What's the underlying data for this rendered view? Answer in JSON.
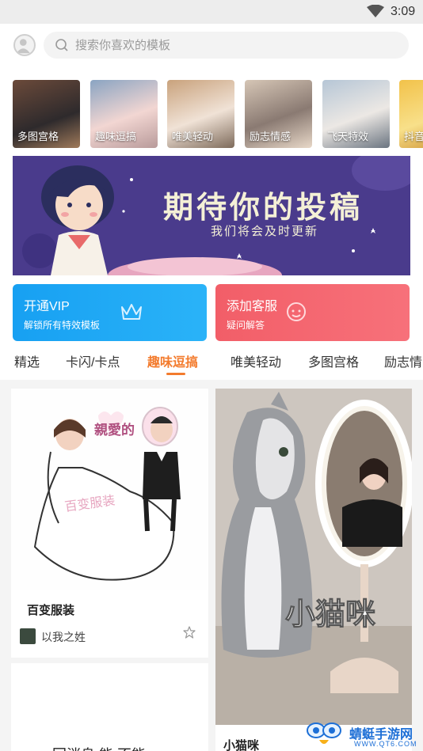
{
  "status_bar": {
    "time": "3:09"
  },
  "search": {
    "placeholder": "搜索你喜欢的模板"
  },
  "categories": [
    {
      "label": "多图宫格"
    },
    {
      "label": "趣味逗搞"
    },
    {
      "label": "唯美轻动"
    },
    {
      "label": "励志情感"
    },
    {
      "label": "飞天特效"
    },
    {
      "label": "抖音"
    }
  ],
  "banner": {
    "title": "期待你的投稿",
    "subtitle": "我们将会及时更新"
  },
  "promos": {
    "vip": {
      "title": "开通VIP",
      "subtitle": "解锁所有特效模板",
      "color": "#1ea6f5"
    },
    "service": {
      "title": "添加客服",
      "subtitle": "疑问解答",
      "color": "#f4606a"
    }
  },
  "tabs": [
    {
      "label": "精选"
    },
    {
      "label": "卡闪/卡点"
    },
    {
      "label": "趣味逗搞"
    },
    {
      "label": "唯美轻动"
    },
    {
      "label": "多图宫格"
    },
    {
      "label": "励志情"
    }
  ],
  "active_tab_color": "#f37b2d",
  "cards": {
    "left": {
      "art_text_top": "親愛的",
      "art_text_bottom": "百变服装",
      "title": "百变服装",
      "author": "以我之姓"
    },
    "left2": {
      "title": "回消息 能 不能"
    },
    "right": {
      "art_text": "小猫咪",
      "title": "小猫咪"
    }
  },
  "watermark": {
    "name": "蜻蜓手游网",
    "url": "WWW.QT6.COM"
  }
}
